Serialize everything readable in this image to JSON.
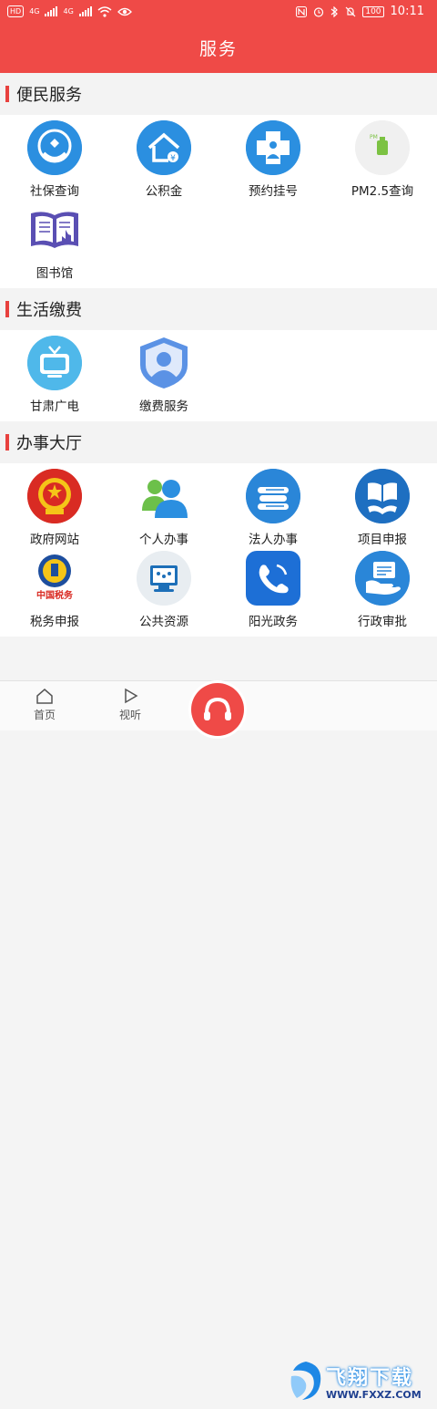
{
  "status_bar": {
    "left_badge": "HD",
    "signal1": "4G",
    "signal2": "4G",
    "battery": "100",
    "time": "10:11"
  },
  "title": "服务",
  "sections": [
    {
      "title": "便民服务",
      "items": [
        {
          "label": "社保查询",
          "icon": "social-security-icon"
        },
        {
          "label": "公积金",
          "icon": "housing-fund-icon"
        },
        {
          "label": "预约挂号",
          "icon": "hospital-registration-icon"
        },
        {
          "label": "PM2.5查询",
          "icon": "pm25-icon"
        },
        {
          "label": "图书馆",
          "icon": "library-icon"
        }
      ]
    },
    {
      "title": "生活缴费",
      "items": [
        {
          "label": "甘肃广电",
          "icon": "tv-icon"
        },
        {
          "label": "缴费服务",
          "icon": "payment-shield-icon"
        }
      ]
    },
    {
      "title": "办事大厅",
      "items": [
        {
          "label": "政府网站",
          "icon": "national-emblem-icon"
        },
        {
          "label": "个人办事",
          "icon": "people-icon"
        },
        {
          "label": "法人办事",
          "icon": "books-icon"
        },
        {
          "label": "项目申报",
          "icon": "book-handshake-icon"
        },
        {
          "label": "税务申报",
          "icon": "tax-emblem-icon"
        },
        {
          "label": "公共资源",
          "icon": "computer-icon"
        },
        {
          "label": "阳光政务",
          "icon": "phone-icon"
        },
        {
          "label": "行政审批",
          "icon": "approval-hand-icon"
        }
      ]
    }
  ],
  "tabbar": {
    "home": "首页",
    "listen": "视听",
    "watermark_text": "飞翔下载",
    "watermark_url": "WWW.FXXZ.COM"
  }
}
